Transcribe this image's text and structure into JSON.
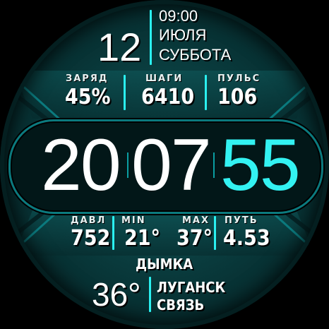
{
  "date": {
    "time": "09:00",
    "day": "12",
    "month": "ИЮЛЯ",
    "weekday": "СУББОТА"
  },
  "stats_top": [
    {
      "label": "ЗАРЯД",
      "value": "45%"
    },
    {
      "label": "ШАГИ",
      "value": "6410"
    },
    {
      "label": "ПУЛЬС",
      "value": "106"
    }
  ],
  "clock": {
    "hours": "20",
    "minutes": "07",
    "seconds": "55"
  },
  "stats_bottom": [
    {
      "label": "ДАВЛ",
      "value": "752"
    },
    {
      "label": "MIN",
      "value": "21°"
    },
    {
      "label": "MAX",
      "value": "37°"
    },
    {
      "label": "ПУТЬ",
      "value": "4.53"
    }
  ],
  "weather": {
    "condition": "ДЫМКА",
    "temperature": "36°",
    "city": "ЛУГАНСК",
    "provider": "СВЯЗЬ"
  },
  "colors": {
    "accent": "#2af0f0",
    "background": "#0a3e40",
    "seconds": "#33f2f2"
  }
}
